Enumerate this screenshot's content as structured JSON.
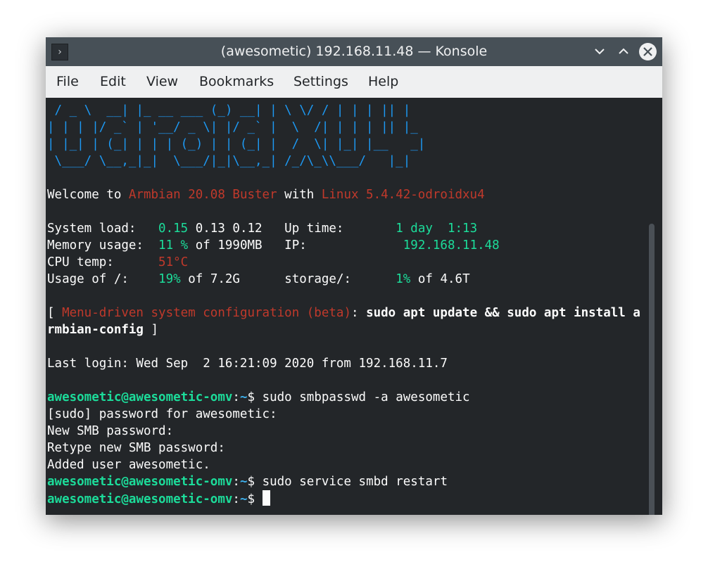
{
  "window": {
    "title": "(awesometic) 192.168.11.48 — Konsole",
    "app_icon": "terminal-prompt-icon",
    "controls": [
      "minimize-icon",
      "maximize-icon",
      "close-icon"
    ]
  },
  "menu": {
    "items": [
      "File",
      "Edit",
      "View",
      "Bookmarks",
      "Settings",
      "Help"
    ]
  },
  "terminal": {
    "ascii": [
      " / _ \\  __| |_ __ ___ (_) __| | \\ \\/ / | | | || |",
      "| | | |/ _` | '__/ _ \\| |/ _` |  \\  /| | | | || |_",
      "| |_| | (_| | | | (_) | | (_| |  /  \\| |_| |__   _|",
      " \\___/ \\__,_|_|  \\___/|_|\\__,_| /_/\\_\\\\___/   |_|"
    ],
    "welcome": {
      "prefix": "Welcome to ",
      "distro": "Armbian 20.08 Buster",
      "middle": " with ",
      "kernel": "Linux 5.4.42-odroidxu4"
    },
    "stats": {
      "system_load_label": "System load:",
      "load_1": "0.15",
      "load_rest": " 0.13 0.12",
      "uptime_label": "Up time:",
      "uptime_value": "1 day  1:13",
      "memory_label": "Memory usage:",
      "memory_pct": "11 %",
      "memory_rest": " of 1990MB",
      "ip_label": "IP:",
      "ip_value": "192.168.11.48",
      "cpu_label": "CPU temp:",
      "cpu_value": "51°C",
      "usage_label": "Usage of /:",
      "usage_pct": "19%",
      "usage_rest": " of 7.2G",
      "storage_label": "storage/:",
      "storage_pct": "1%",
      "storage_rest": " of 4.6T"
    },
    "config_hint": {
      "open": "[ ",
      "text": "Menu-driven system configuration (beta)",
      "colon": ": ",
      "cmd1": "sudo apt update && sudo apt install a",
      "cmd2": "rmbian-config",
      "close": " ]"
    },
    "last_login": "Last login: Wed Sep  2 16:21:09 2020 from 192.168.11.7",
    "prompt": {
      "user_host": "awesometic@awesometic-omv",
      "sep": ":",
      "path": "~",
      "dollar": "$ "
    },
    "history": {
      "cmd1": "sudo smbpasswd -a awesometic",
      "out1": "[sudo] password for awesometic:",
      "out2": "New SMB password:",
      "out3": "Retype new SMB password:",
      "out4": "Added user awesometic.",
      "cmd2": "sudo service smbd restart"
    }
  }
}
